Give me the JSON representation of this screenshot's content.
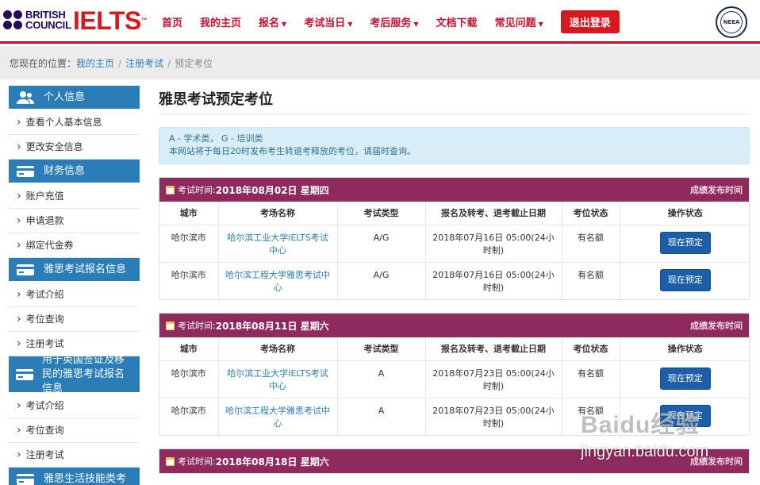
{
  "header": {
    "bc_line1": "BRITISH",
    "bc_line2": "COUNCIL",
    "ielts_logo": "IELTS",
    "ielts_tm": "™",
    "nav": [
      {
        "label": "首页",
        "caret": false
      },
      {
        "label": "我的主页",
        "caret": false
      },
      {
        "label": "报名",
        "caret": true
      },
      {
        "label": "考试当日",
        "caret": true
      },
      {
        "label": "考后服务",
        "caret": true
      },
      {
        "label": "文档下载",
        "caret": false
      },
      {
        "label": "常见问题",
        "caret": true
      }
    ],
    "logout_label": "退出登录",
    "seal_text": "NEEA"
  },
  "breadcrumb": {
    "prefix": "您现在的位置：",
    "home": "我的主页",
    "section": "注册考试",
    "current": "预定考位",
    "separator": "/"
  },
  "sidebar": {
    "sections": [
      {
        "title": "个人信息",
        "icon": "user-icon",
        "items": [
          "查看个人基本信息",
          "更改安全信息"
        ]
      },
      {
        "title": "财务信息",
        "icon": "card-icon",
        "items": [
          "账户充值",
          "申请退款",
          "绑定代金券"
        ]
      },
      {
        "title": "雅思考试报名信息",
        "icon": "card-icon",
        "items": [
          "考试介绍",
          "考位查询",
          "注册考试"
        ]
      },
      {
        "title": "用于英国签证及移民的雅思考试报名信息",
        "icon": "card-icon",
        "items": [
          "考试介绍",
          "考位查询",
          "注册考试"
        ]
      },
      {
        "title": "雅思生活技能类考",
        "icon": "card-icon",
        "items": []
      }
    ]
  },
  "main": {
    "title": "雅思考试预定考位",
    "info_line1": "A - 学术类， G - 培训类",
    "info_line2": "本网站将于每日20时发布考生转退考释放的考位，请届时查询。",
    "columns": [
      "城市",
      "考场名称",
      "考试类型",
      "报名及转考、退考截止日期",
      "考位状态",
      "操作状态"
    ],
    "book_label": "现在预定",
    "result_link": "成绩发布时间",
    "date_prefix": "考试时间:",
    "exams": [
      {
        "date": "2018年08月02日 星期四",
        "rows": [
          {
            "city": "哈尔滨市",
            "venue": "哈尔滨工业大学IELTS考试中心",
            "type": "A/G",
            "deadline": "2018年07月16日 05:00(24小时制)",
            "status": "有名额"
          },
          {
            "city": "哈尔滨市",
            "venue": "哈尔滨工程大学雅思考试中心",
            "type": "A/G",
            "deadline": "2018年07月16日 05:00(24小时制)",
            "status": "有名额"
          }
        ]
      },
      {
        "date": "2018年08月11日 星期六",
        "rows": [
          {
            "city": "哈尔滨市",
            "venue": "哈尔滨工业大学IELTS考试中心",
            "type": "A",
            "deadline": "2018年07月23日 05:00(24小时制)",
            "status": "有名额"
          },
          {
            "city": "哈尔滨市",
            "venue": "哈尔滨工程大学雅思考试中心",
            "type": "A",
            "deadline": "2018年07月23日 05:00(24小时制)",
            "status": "有名额"
          }
        ]
      },
      {
        "date": "2018年08月18日 星期六",
        "rows": []
      }
    ]
  },
  "watermark": {
    "logo": "Baidu经验",
    "url": "jingyan.baidu.com"
  },
  "colors": {
    "brand_red": "#c8102e",
    "sidebar_blue": "#2a7db7",
    "panel_header": "#8e2a5d",
    "info_bg": "#d9edf7",
    "book_button": "#1c5fa8"
  }
}
